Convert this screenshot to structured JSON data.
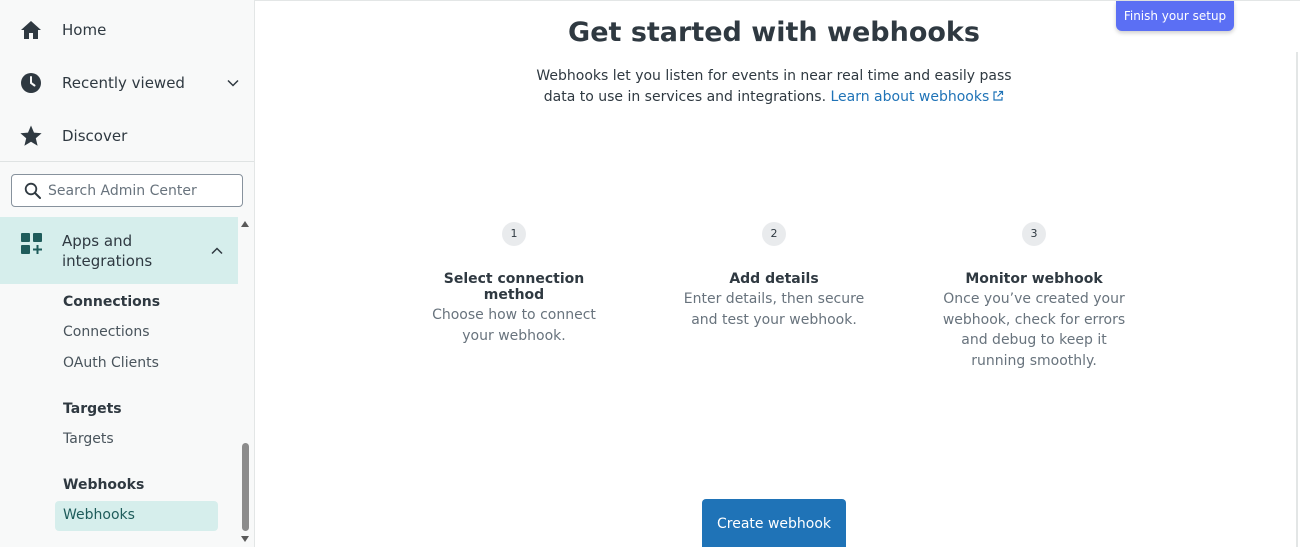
{
  "sidebar": {
    "home": "Home",
    "recently_viewed": "Recently viewed",
    "discover": "Discover",
    "search_placeholder": "Search Admin Center",
    "apps_section": "Apps and integrations",
    "groups": [
      {
        "heading": "Connections",
        "links": [
          "Connections",
          "OAuth Clients"
        ]
      },
      {
        "heading": "Targets",
        "links": [
          "Targets"
        ]
      },
      {
        "heading": "Webhooks",
        "links": [
          "Webhooks"
        ]
      }
    ]
  },
  "main": {
    "finish_setup": "Finish your setup",
    "title": "Get started with webhooks",
    "subtitle": "Webhooks let you listen for events in near real time and easily pass data to use in services and integrations.",
    "learn_link": "Learn about webhooks",
    "steps": [
      {
        "num": "1",
        "title": "Select connection method",
        "desc": "Choose how to connect your webhook."
      },
      {
        "num": "2",
        "title": "Add details",
        "desc": "Enter details, then secure and test your webhook."
      },
      {
        "num": "3",
        "title": "Monitor webhook",
        "desc": "Once you’ve created your webhook, check for errors and debug to keep it running smoothly."
      }
    ],
    "create_button": "Create webhook"
  },
  "colors": {
    "accent": "#1f73b7",
    "finish_button": "#5b6ff4",
    "active_bg": "#d6eeec"
  }
}
